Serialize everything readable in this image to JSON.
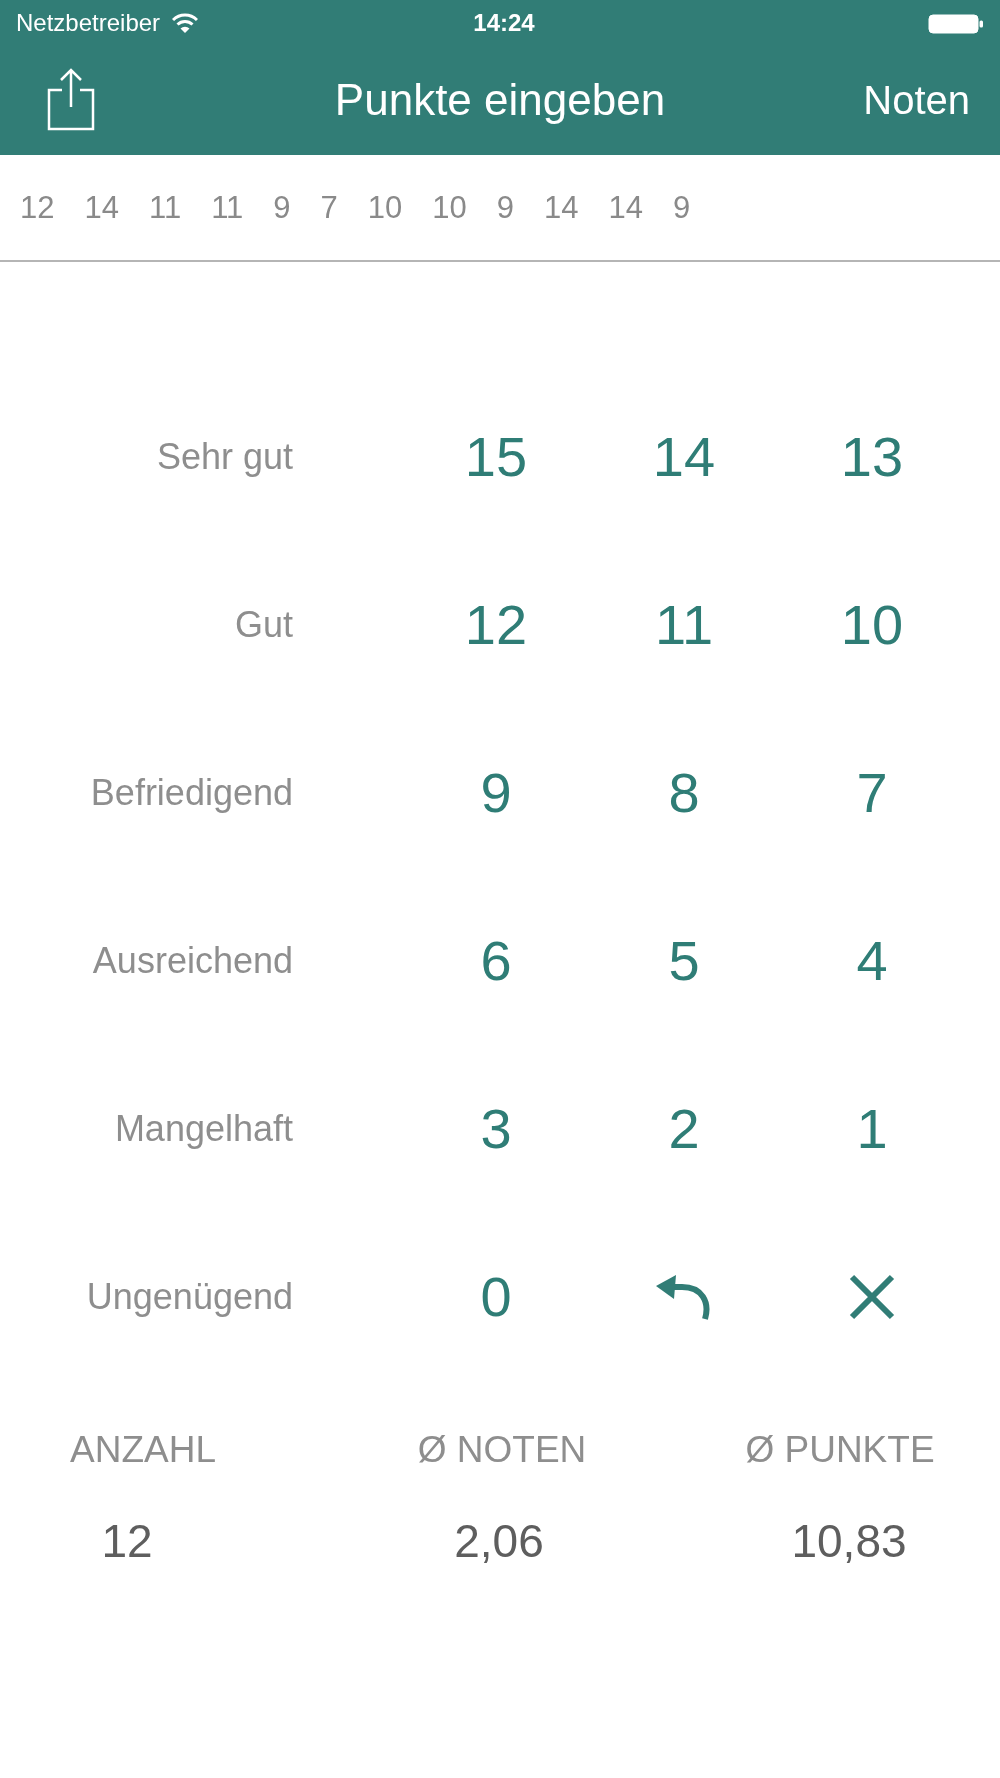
{
  "status_bar": {
    "carrier": "Netzbetreiber",
    "time": "14:24"
  },
  "nav_bar": {
    "title": "Punkte eingeben",
    "right_button": "Noten"
  },
  "entered_points": [
    "12",
    "14",
    "11",
    "11",
    "9",
    "7",
    "10",
    "10",
    "9",
    "14",
    "14",
    "9"
  ],
  "keypad": [
    {
      "grade": "Sehr gut",
      "keys": [
        {
          "kind": "digit",
          "label": "15"
        },
        {
          "kind": "digit",
          "label": "14"
        },
        {
          "kind": "digit",
          "label": "13"
        }
      ]
    },
    {
      "grade": "Gut",
      "keys": [
        {
          "kind": "digit",
          "label": "12"
        },
        {
          "kind": "digit",
          "label": "11"
        },
        {
          "kind": "digit",
          "label": "10"
        }
      ]
    },
    {
      "grade": "Befriedigend",
      "keys": [
        {
          "kind": "digit",
          "label": "9"
        },
        {
          "kind": "digit",
          "label": "8"
        },
        {
          "kind": "digit",
          "label": "7"
        }
      ]
    },
    {
      "grade": "Ausreichend",
      "keys": [
        {
          "kind": "digit",
          "label": "6"
        },
        {
          "kind": "digit",
          "label": "5"
        },
        {
          "kind": "digit",
          "label": "4"
        }
      ]
    },
    {
      "grade": "Mangelhaft",
      "keys": [
        {
          "kind": "digit",
          "label": "3"
        },
        {
          "kind": "digit",
          "label": "2"
        },
        {
          "kind": "digit",
          "label": "1"
        }
      ]
    },
    {
      "grade": "Ungenügend",
      "keys": [
        {
          "kind": "digit",
          "label": "0"
        },
        {
          "kind": "undo"
        },
        {
          "kind": "clear"
        }
      ]
    }
  ],
  "summary": [
    {
      "label": "ANZAHL",
      "value": "12"
    },
    {
      "label": "Ø NOTEN",
      "value": "2,06"
    },
    {
      "label": "Ø PUNKTE",
      "value": "10,83"
    }
  ]
}
